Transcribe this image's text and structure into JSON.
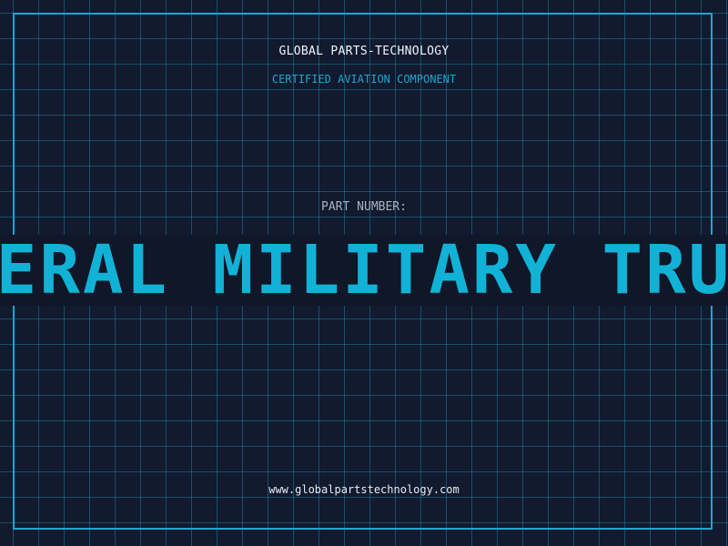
{
  "header": {
    "company": "GLOBAL PARTS-TECHNOLOGY",
    "subtitle": "CERTIFIED AVIATION COMPONENT"
  },
  "part": {
    "label": "PART NUMBER:",
    "value": "GENERAL MILITARY TRUCKS"
  },
  "footer": {
    "website": "www.globalpartstechnology.com"
  },
  "colors": {
    "background": "#111a2e",
    "accent": "#1fa6cf",
    "part_text": "#12b2d6"
  }
}
